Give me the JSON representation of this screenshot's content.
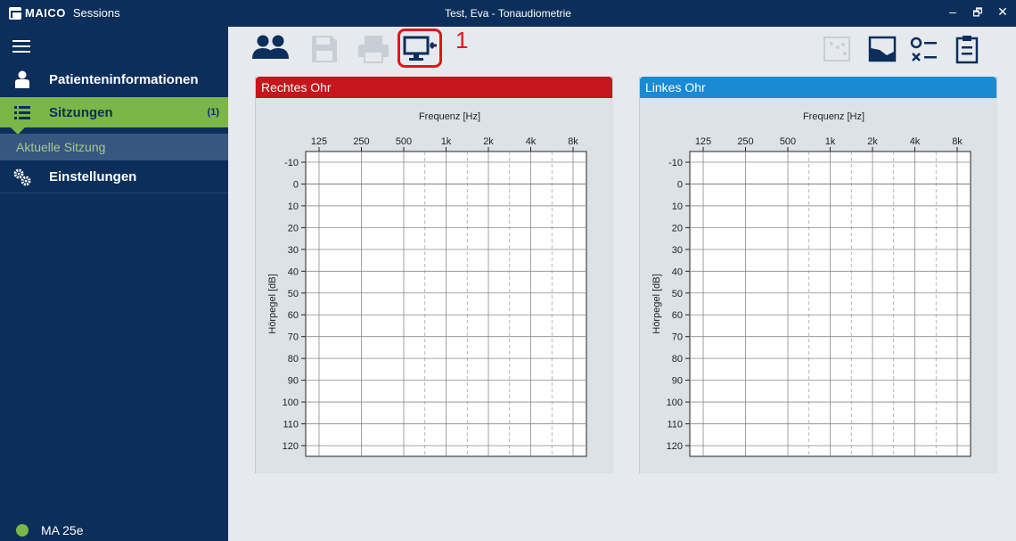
{
  "titlebar": {
    "brand": "MAICO",
    "app": "Sessions",
    "title": "Test, Eva - Tonaudiometrie",
    "minimize": "–",
    "maximize": "🗗",
    "close": "✕"
  },
  "sidebar": {
    "items": [
      {
        "label": "Patienteninformationen",
        "icon": "person-icon"
      },
      {
        "label": "Sitzungen",
        "icon": "list-icon",
        "count": "(1)"
      },
      {
        "label": "Einstellungen",
        "icon": "gears-icon"
      }
    ],
    "sub_item": "Aktuelle Sitzung",
    "device": "MA 25e"
  },
  "toolbar": {
    "callout": "1",
    "icons": [
      "patients-icon",
      "save-icon",
      "print-icon",
      "monitor-transfer-icon",
      "chart-points-icon",
      "chart-area-icon",
      "checklist-icon",
      "clipboard-icon"
    ]
  },
  "panels": {
    "right_title": "Rechtes Ohr",
    "left_title": "Linkes Ohr",
    "right_color": "#c4161c",
    "left_color": "#1b8ad3"
  },
  "audiogram": {
    "x_label": "Frequenz [Hz]",
    "y_label": "Hörpegel [dB]",
    "x_ticks": [
      "125",
      "250",
      "500",
      "1k",
      "2k",
      "4k",
      "8k"
    ],
    "y_ticks": [
      "-10",
      "0",
      "10",
      "20",
      "30",
      "40",
      "50",
      "60",
      "70",
      "80",
      "90",
      "100",
      "110",
      "120"
    ],
    "y_range": [
      -10,
      120
    ],
    "grid": true
  }
}
